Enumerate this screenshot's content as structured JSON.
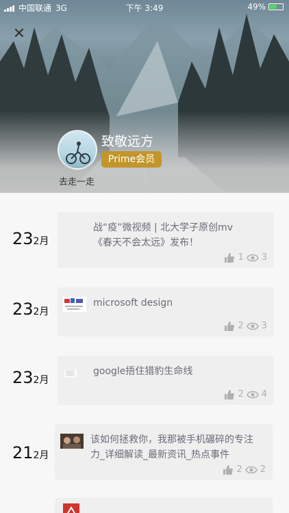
{
  "status": {
    "carrier": "中国联通",
    "network": "3G",
    "time": "下午 3:49",
    "battery": "49%"
  },
  "header": {
    "name": "致敬远方",
    "badge": "Prime会员",
    "motto": "去走一走"
  },
  "colors": {
    "badge": "#c2962a",
    "card": "#efefef",
    "meta": "#b0b0b0",
    "title": "#6b6b7a"
  },
  "entries": [
    {
      "day": "23",
      "month": "2月",
      "title": "战“疫”微视频 | 北大学子原创mv《春天不会太远》发布！",
      "likes": "1",
      "views": "3"
    },
    {
      "day": "23",
      "month": "2月",
      "title": "microsoft design",
      "likes": "2",
      "views": "3"
    },
    {
      "day": "23",
      "month": "2月",
      "title": "google捂住猎豹生命线",
      "likes": "2",
      "views": "4"
    },
    {
      "day": "21",
      "month": "2月",
      "title": "该如何拯救你，我那被手机碾碎的专注力_详细解读_最新资讯_热点事件",
      "likes": "2",
      "views": "2"
    }
  ]
}
